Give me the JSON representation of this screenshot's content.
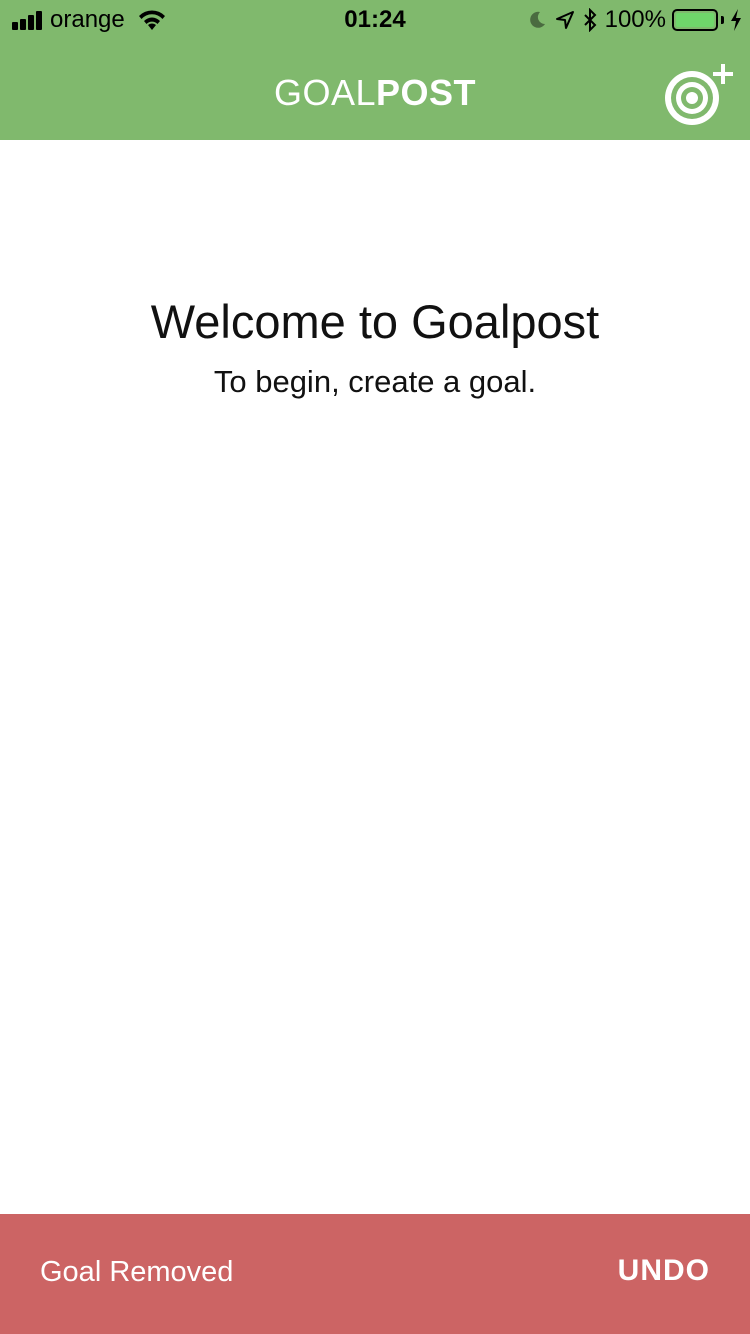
{
  "status_bar": {
    "carrier": "orange",
    "time": "01:24",
    "battery_percent": "100%",
    "battery_level": 1.0,
    "icons": [
      "signal-icon",
      "wifi-icon",
      "moon-icon",
      "location-icon",
      "bluetooth-icon",
      "battery-icon",
      "charging-icon"
    ]
  },
  "navbar": {
    "title_light": "GOAL",
    "title_bold": "POST",
    "add_goal_icon": "target-plus-icon",
    "background_color": "#80b96d"
  },
  "main": {
    "welcome_title": "Welcome to Goalpost",
    "welcome_subtitle": "To begin, create a goal."
  },
  "snackbar": {
    "message": "Goal Removed",
    "action_label": "UNDO",
    "background_color": "#cc6464"
  }
}
